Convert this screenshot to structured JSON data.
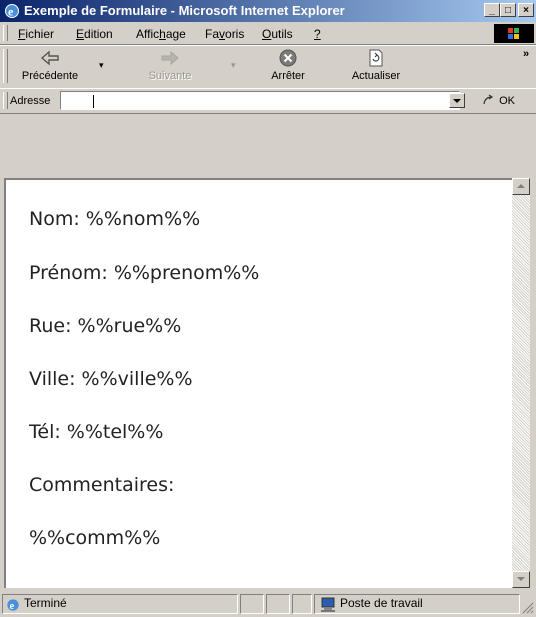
{
  "window": {
    "title": "Exemple de Formulaire - Microsoft Internet Explorer",
    "min_label": "_",
    "max_label": "□",
    "close_label": "×"
  },
  "menubar": {
    "items": [
      {
        "label": "Fichier"
      },
      {
        "label": "Edition"
      },
      {
        "label": "Affichage"
      },
      {
        "label": "Favoris"
      },
      {
        "label": "Outils"
      },
      {
        "label": "?"
      }
    ]
  },
  "toolbar": {
    "back": {
      "label": "Précédente",
      "icon": "back-arrow-icon"
    },
    "forward": {
      "label": "Suivante",
      "icon": "forward-arrow-icon",
      "disabled": true
    },
    "stop": {
      "label": "Arrêter",
      "icon": "stop-icon"
    },
    "refresh": {
      "label": "Actualiser",
      "icon": "refresh-icon"
    },
    "more": "»"
  },
  "addressbar": {
    "label": "Adresse",
    "value": "",
    "go_label": "OK"
  },
  "page": {
    "fields": [
      {
        "text": "Nom: %%nom%%"
      },
      {
        "text": "Prénom: %%prenom%%"
      },
      {
        "text": "Rue: %%rue%%"
      },
      {
        "text": "Ville: %%ville%%"
      },
      {
        "text": "Tél: %%tel%%"
      },
      {
        "text": "Commentaires:"
      },
      {
        "text": "%%comm%%"
      }
    ]
  },
  "status": {
    "text": "Terminé",
    "zone": "Poste de travail"
  },
  "colors": {
    "title_active": "#0a246a",
    "title_gradient_end": "#a6caf0",
    "chrome": "#d4d0c8",
    "stop_icon": "#7b7b7b"
  }
}
